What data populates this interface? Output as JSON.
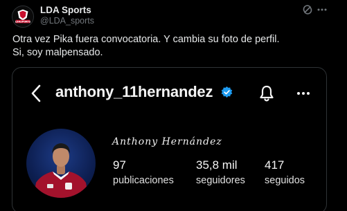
{
  "tweet": {
    "author_name": "LDA Sports",
    "author_handle": "@LDA_sports",
    "avatar_text": "LDASPORTS",
    "text_line1": "Otra vez Pika fuera convocatoria. Y cambia su foto de perfil.",
    "text_line2": "Si, soy malpensado."
  },
  "instagram": {
    "username": "anthony_11hernandez",
    "display_name": "Anthony Hernández",
    "stats": {
      "posts_value": "97",
      "posts_label": "publicaciones",
      "followers_value": "35,8 mil",
      "followers_label": "seguidores",
      "following_value": "417",
      "following_label": "seguidos"
    }
  },
  "icons": {
    "grok": "grok-icon",
    "more": "more-icon",
    "back": "chevron-left-icon",
    "verified": "verified-badge-icon",
    "bell": "bell-icon",
    "options": "ellipsis-icon"
  },
  "colors": {
    "background": "#000000",
    "text_primary": "#e7e9ea",
    "text_secondary": "#71767b",
    "border": "#2f3336",
    "verified_blue": "#1d9bf0",
    "avatar_red": "#c8102e"
  }
}
